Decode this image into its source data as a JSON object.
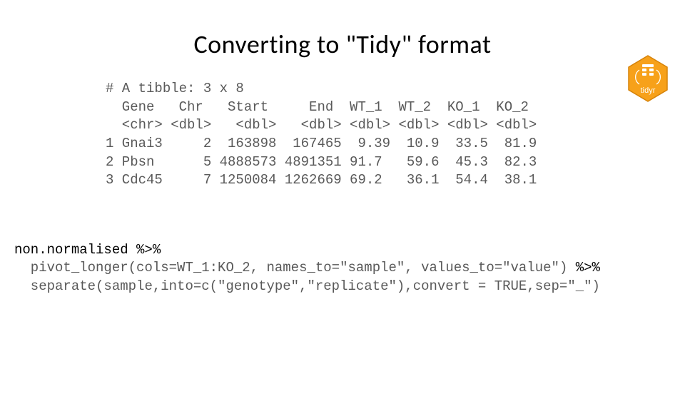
{
  "title": "Converting to \"Tidy\" format",
  "logo_label": "tidyr",
  "tibble": {
    "header": "# A tibble: 3 x 8",
    "cols_line": "  Gene   Chr   Start     End  WT_1  WT_2  KO_1  KO_2",
    "types_line": "  <chr> <dbl>   <dbl>   <dbl> <dbl> <dbl> <dbl> <dbl>",
    "row1": "1 Gnai3     2  163898  167465  9.39  10.9  33.5  81.9",
    "row2": "2 Pbsn      5 4888573 4891351 91.7   59.6  45.3  82.3",
    "row3": "3 Cdc45     7 1250084 1262669 69.2   36.1  54.4  38.1"
  },
  "code": {
    "l1a": "non.normalised ",
    "l1b": "%>%",
    "l2func": "  pivot_longer",
    "l2args": "(cols=WT_1:KO_2, names_to=\"sample\", values_to=\"value\") ",
    "l2pipe": "%>%",
    "l3func": "  separate",
    "l3args": "(sample,into=c(\"genotype\",\"replicate\"),convert = TRUE,sep=\"_\")"
  }
}
